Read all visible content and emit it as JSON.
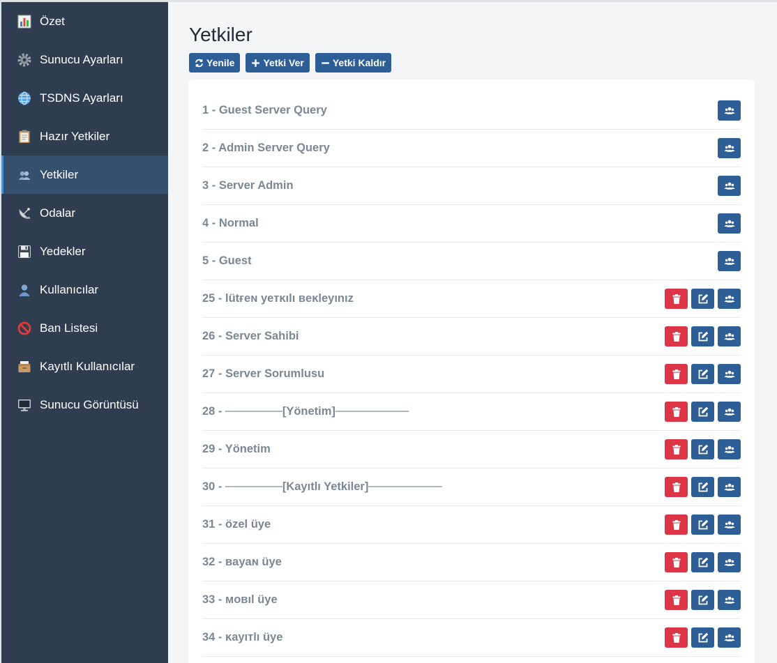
{
  "sidebar": {
    "items": [
      {
        "label": "Özet",
        "icon": "chart-icon",
        "active": false
      },
      {
        "label": "Sunucu Ayarları",
        "icon": "gear-icon",
        "active": false
      },
      {
        "label": "TSDNS Ayarları",
        "icon": "globe-icon",
        "active": false
      },
      {
        "label": "Hazır Yetkiler",
        "icon": "clipboard-icon",
        "active": false
      },
      {
        "label": "Yetkiler",
        "icon": "users-icon",
        "active": true
      },
      {
        "label": "Odalar",
        "icon": "satellite-icon",
        "active": false
      },
      {
        "label": "Yedekler",
        "icon": "floppy-disk-icon",
        "active": false
      },
      {
        "label": "Kullanıcılar",
        "icon": "user-icon",
        "active": false
      },
      {
        "label": "Ban Listesi",
        "icon": "prohibited-icon",
        "active": false
      },
      {
        "label": "Kayıtlı Kullanıcılar",
        "icon": "card-box-icon",
        "active": false
      },
      {
        "label": "Sunucu Görüntüsü",
        "icon": "monitor-icon",
        "active": false
      }
    ]
  },
  "main": {
    "title": "Yetkiler",
    "toolbar": {
      "refresh_label": "Yenile",
      "grant_label": "Yetki Ver",
      "revoke_label": "Yetki Kaldır"
    },
    "groups": [
      {
        "label": "1 - Guest Server Query",
        "editable": false
      },
      {
        "label": "2 - Admin Server Query",
        "editable": false
      },
      {
        "label": "3 - Server Admin",
        "editable": false
      },
      {
        "label": "4 - Normal",
        "editable": false
      },
      {
        "label": "5 - Guest",
        "editable": false
      },
      {
        "label": "25 - lütғeɴ yeтĸılı вeĸleyınız",
        "editable": true
      },
      {
        "label": "26 - Server Sahibi",
        "editable": true
      },
      {
        "label": "27 - Server Sorumlusu",
        "editable": true
      },
      {
        "label": "28 - ───────[Yönetim]─────────",
        "editable": true
      },
      {
        "label": "29 - Yönetim",
        "editable": true
      },
      {
        "label": "30 - ───────[Kayıtlı Yetkiler]─────────",
        "editable": true
      },
      {
        "label": "31 - özel üye",
        "editable": true
      },
      {
        "label": "32 - вayaɴ üye",
        "editable": true
      },
      {
        "label": "33 - мoвıl üye",
        "editable": true
      },
      {
        "label": "34 - ĸayıтlı üye",
        "editable": true
      }
    ]
  },
  "colors": {
    "sidebar_bg": "#2e3e50",
    "sidebar_active": "#34506d",
    "primary": "#2d5f96",
    "danger": "#dc3545"
  }
}
